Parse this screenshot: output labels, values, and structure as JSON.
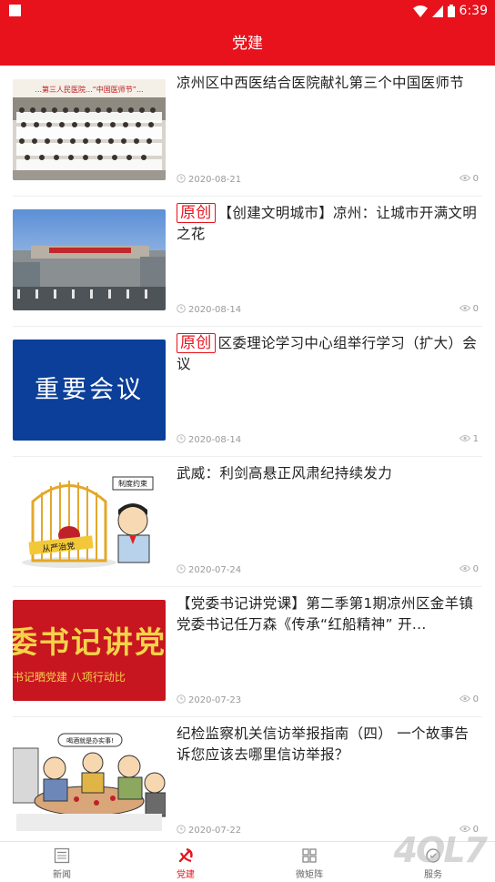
{
  "status": {
    "time": "6:39"
  },
  "header": {
    "title": "党建"
  },
  "badge_text": "原创",
  "articles": [
    {
      "title": "凉州区中西医结合医院献礼第三个中国医师节",
      "badge": false,
      "date": "2020-08-21",
      "views": "0"
    },
    {
      "title": "【创建文明城市】凉州：让城市开满文明之花",
      "badge": true,
      "date": "2020-08-14",
      "views": "0"
    },
    {
      "title": "区委理论学习中心组举行学习（扩大）会议",
      "badge": true,
      "date": "2020-08-14",
      "views": "1"
    },
    {
      "title": "武威：利剑高悬正风肃纪持续发力",
      "badge": false,
      "date": "2020-07-24",
      "views": "0"
    },
    {
      "title": "【党委书记讲党课】第二季第1期凉州区金羊镇党委书记任万森《传承“红船精神” 开...",
      "badge": false,
      "date": "2020-07-23",
      "views": "0"
    },
    {
      "title": "纪检监察机关信访举报指南（四） 一个故事告诉您应该去哪里信访举报？",
      "badge": false,
      "date": "2020-07-22",
      "views": "0"
    }
  ],
  "thumbs": {
    "img1_banner": "...第三人民医院...“中国医师节”...",
    "img3_text": "重要会议",
    "img4_sign1": "从严治党",
    "img4_sign2": "制度约束",
    "img5_text1": "委书记讲党",
    "img5_text2": "书记晒党建  八项行动比",
    "img6_bubble": "喝酒就是办实事!"
  },
  "tabs": [
    {
      "label": "新闻",
      "icon": "newspaper-icon"
    },
    {
      "label": "党建",
      "icon": "party-emblem-icon"
    },
    {
      "label": "微矩阵",
      "icon": "grid-icon"
    },
    {
      "label": "服务",
      "icon": "service-icon"
    }
  ],
  "watermark": "4OL7",
  "colors": {
    "accent": "#e8121c"
  }
}
